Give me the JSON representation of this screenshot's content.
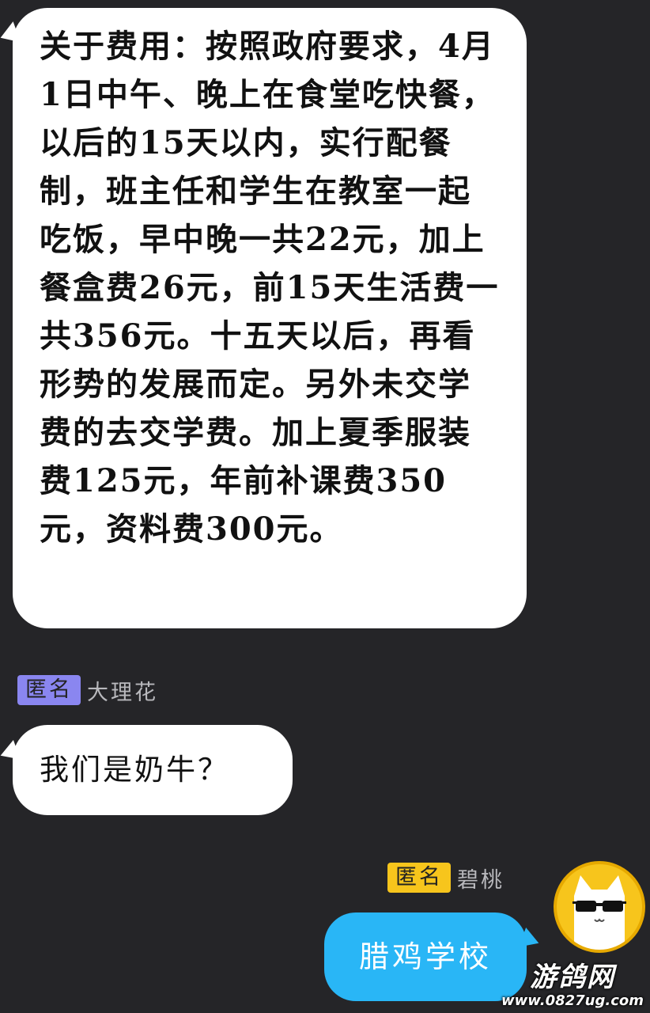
{
  "messages": [
    {
      "side": "left",
      "text": "关于费用：按照政府要求，4月1日中午、晚上在食堂吃快餐，以后的15天以内，实行配餐制，班主任和学生在教室一起吃饭，早中晚一共22元，加上餐盒费26元，前15天生活费一共356元。十五天以后，再看形势的发展而定。另外未交学费的去交学费。加上夏季服装费125元，年前补课费350元，资料费300元。"
    },
    {
      "side": "left",
      "sender_tag": "匿名",
      "sender_name": "大理花",
      "tag_color": "#8a86f0",
      "text": "我们是奶牛？"
    },
    {
      "side": "right",
      "sender_tag": "匿名",
      "sender_name": "碧桃",
      "tag_color": "#f7c51c",
      "text": "腊鸡学校",
      "avatar": "cat-with-sunglasses-icon"
    }
  ],
  "colors": {
    "background": "#252528",
    "bubble_incoming": "#ffffff",
    "bubble_outgoing": "#29b6f6"
  },
  "watermark": {
    "title": "游鸽网",
    "url": "www.0827ug.com"
  }
}
